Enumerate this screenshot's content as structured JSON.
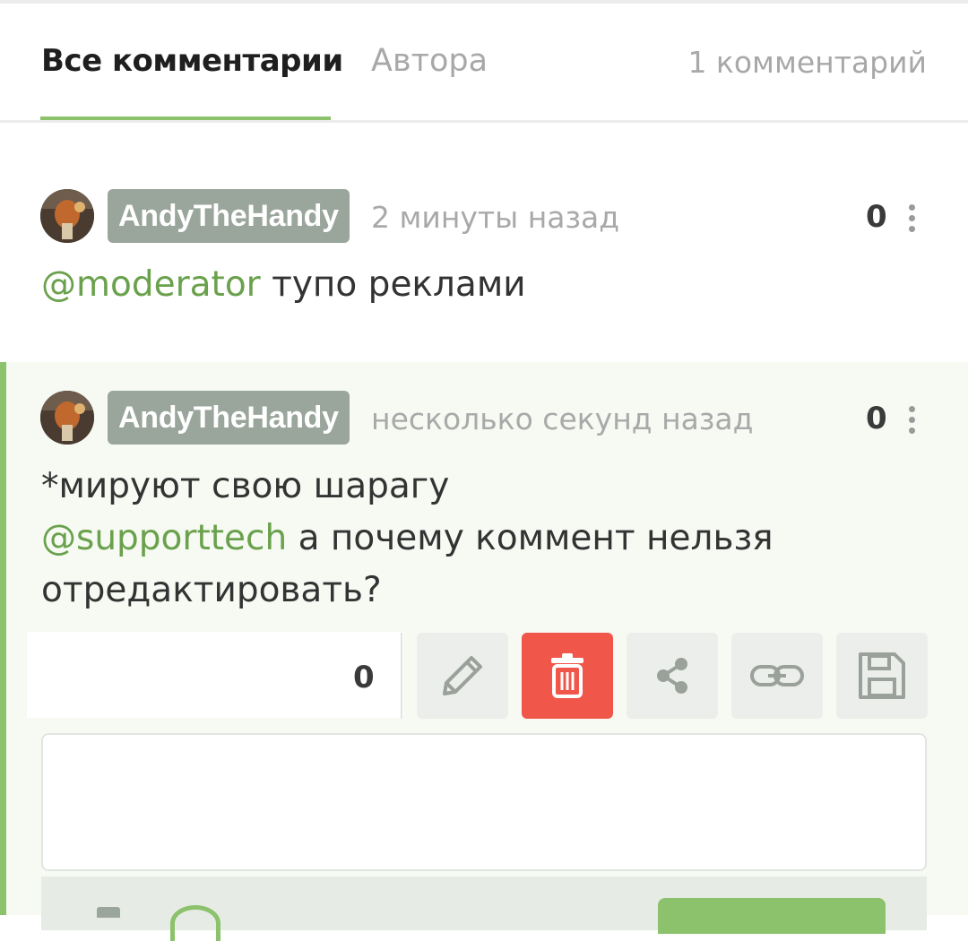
{
  "tabs": {
    "all_label": "Все комментарии",
    "author_label": "Автора",
    "count_label": "1 комментарий"
  },
  "comments": [
    {
      "username": "AndyTheHandy",
      "time": "2 минуты назад",
      "rating": "0",
      "mention": "@moderator",
      "text": " тупо реклами"
    },
    {
      "username": "AndyTheHandy",
      "time": "несколько секунд назад",
      "rating": "0",
      "line1": "*мируют свою шарагу",
      "mention": "@supporttech",
      "line2": " а почему коммент нельзя",
      "line3": "отредактировать?"
    }
  ],
  "actions": {
    "count": "0",
    "buttons": [
      "edit-icon",
      "trash-icon",
      "share-icon",
      "link-icon",
      "save-icon"
    ]
  },
  "colors": {
    "accent": "#8cc26b",
    "mention": "#6aa14c",
    "badge": "#9aa59b",
    "delete": "#f0574a"
  }
}
